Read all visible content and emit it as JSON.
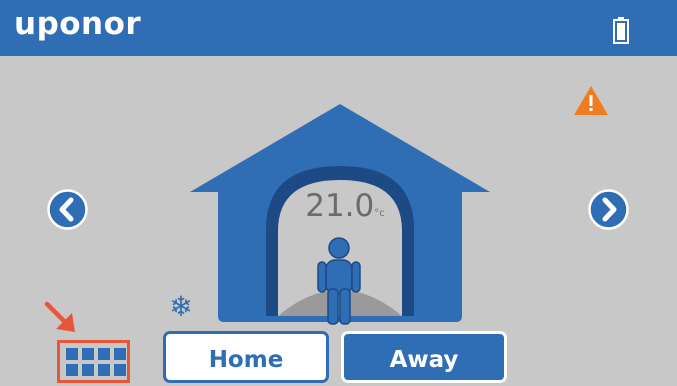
{
  "header": {
    "brand": "uponor",
    "brand_color": "#2f6db5",
    "battery_icon": "battery-full-icon"
  },
  "status": {
    "warning_icon": "warning-icon",
    "warning_color": "#f07c22"
  },
  "room": {
    "temperature": "21.0",
    "unit": "°c",
    "cooling_icon": "snowflake-icon"
  },
  "navigation": {
    "prev_icon": "chevron-left-icon",
    "next_icon": "chevron-right-icon"
  },
  "schedule": {
    "icon": "calendar-grid-icon",
    "highlight_color": "#e8563a"
  },
  "modes": {
    "home_label": "Home",
    "away_label": "Away",
    "selected": "Away"
  }
}
